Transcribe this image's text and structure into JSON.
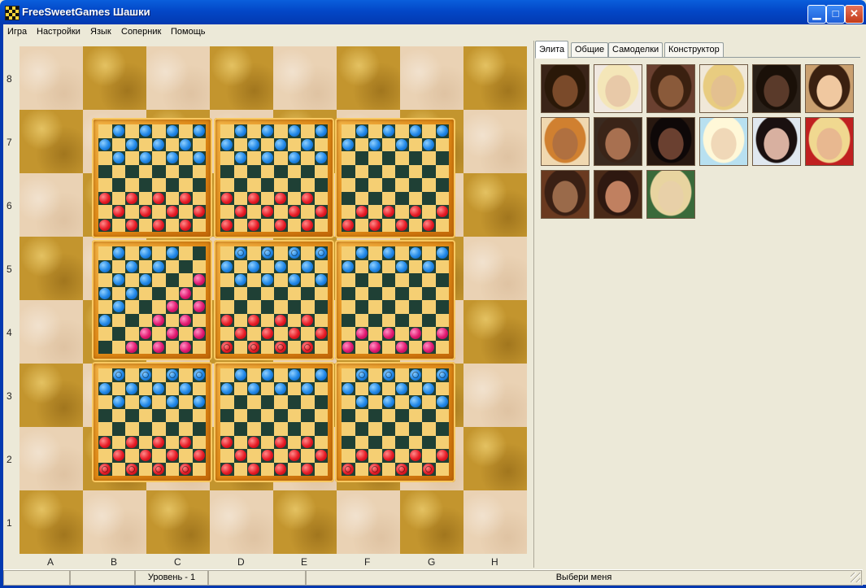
{
  "window": {
    "title": "FreeSweetGames Шашки",
    "icon": "checkers-board-icon",
    "controls": [
      "minimize",
      "maximize",
      "close"
    ]
  },
  "menu": [
    "Игра",
    "Настройки",
    "Язык",
    "Соперник",
    "Помощь"
  ],
  "board": {
    "ranks": [
      "8",
      "7",
      "6",
      "5",
      "4",
      "3",
      "2",
      "1"
    ],
    "files": [
      "A",
      "B",
      "C",
      "D",
      "E",
      "F",
      "G",
      "H"
    ],
    "colors": {
      "light": "#ead2b4",
      "dark": "#c3952e"
    },
    "game_variants": 9
  },
  "tabs": {
    "items": [
      "Элита",
      "Общие",
      "Самоделки",
      "Конструктор"
    ],
    "active": "Элита"
  },
  "opponents": {
    "count": 15,
    "per_row": 6
  },
  "status": {
    "cells": [
      "",
      "",
      "Уровень - 1",
      "",
      "Выбери меня"
    ]
  },
  "colors": {
    "titlebar": "#0347c7",
    "piece_blue": "#1f86e6",
    "piece_red": "#e61a25",
    "piece_pink": "#e0176e",
    "mini_light": "#f5cf73",
    "mini_dark": "#1f4035"
  }
}
